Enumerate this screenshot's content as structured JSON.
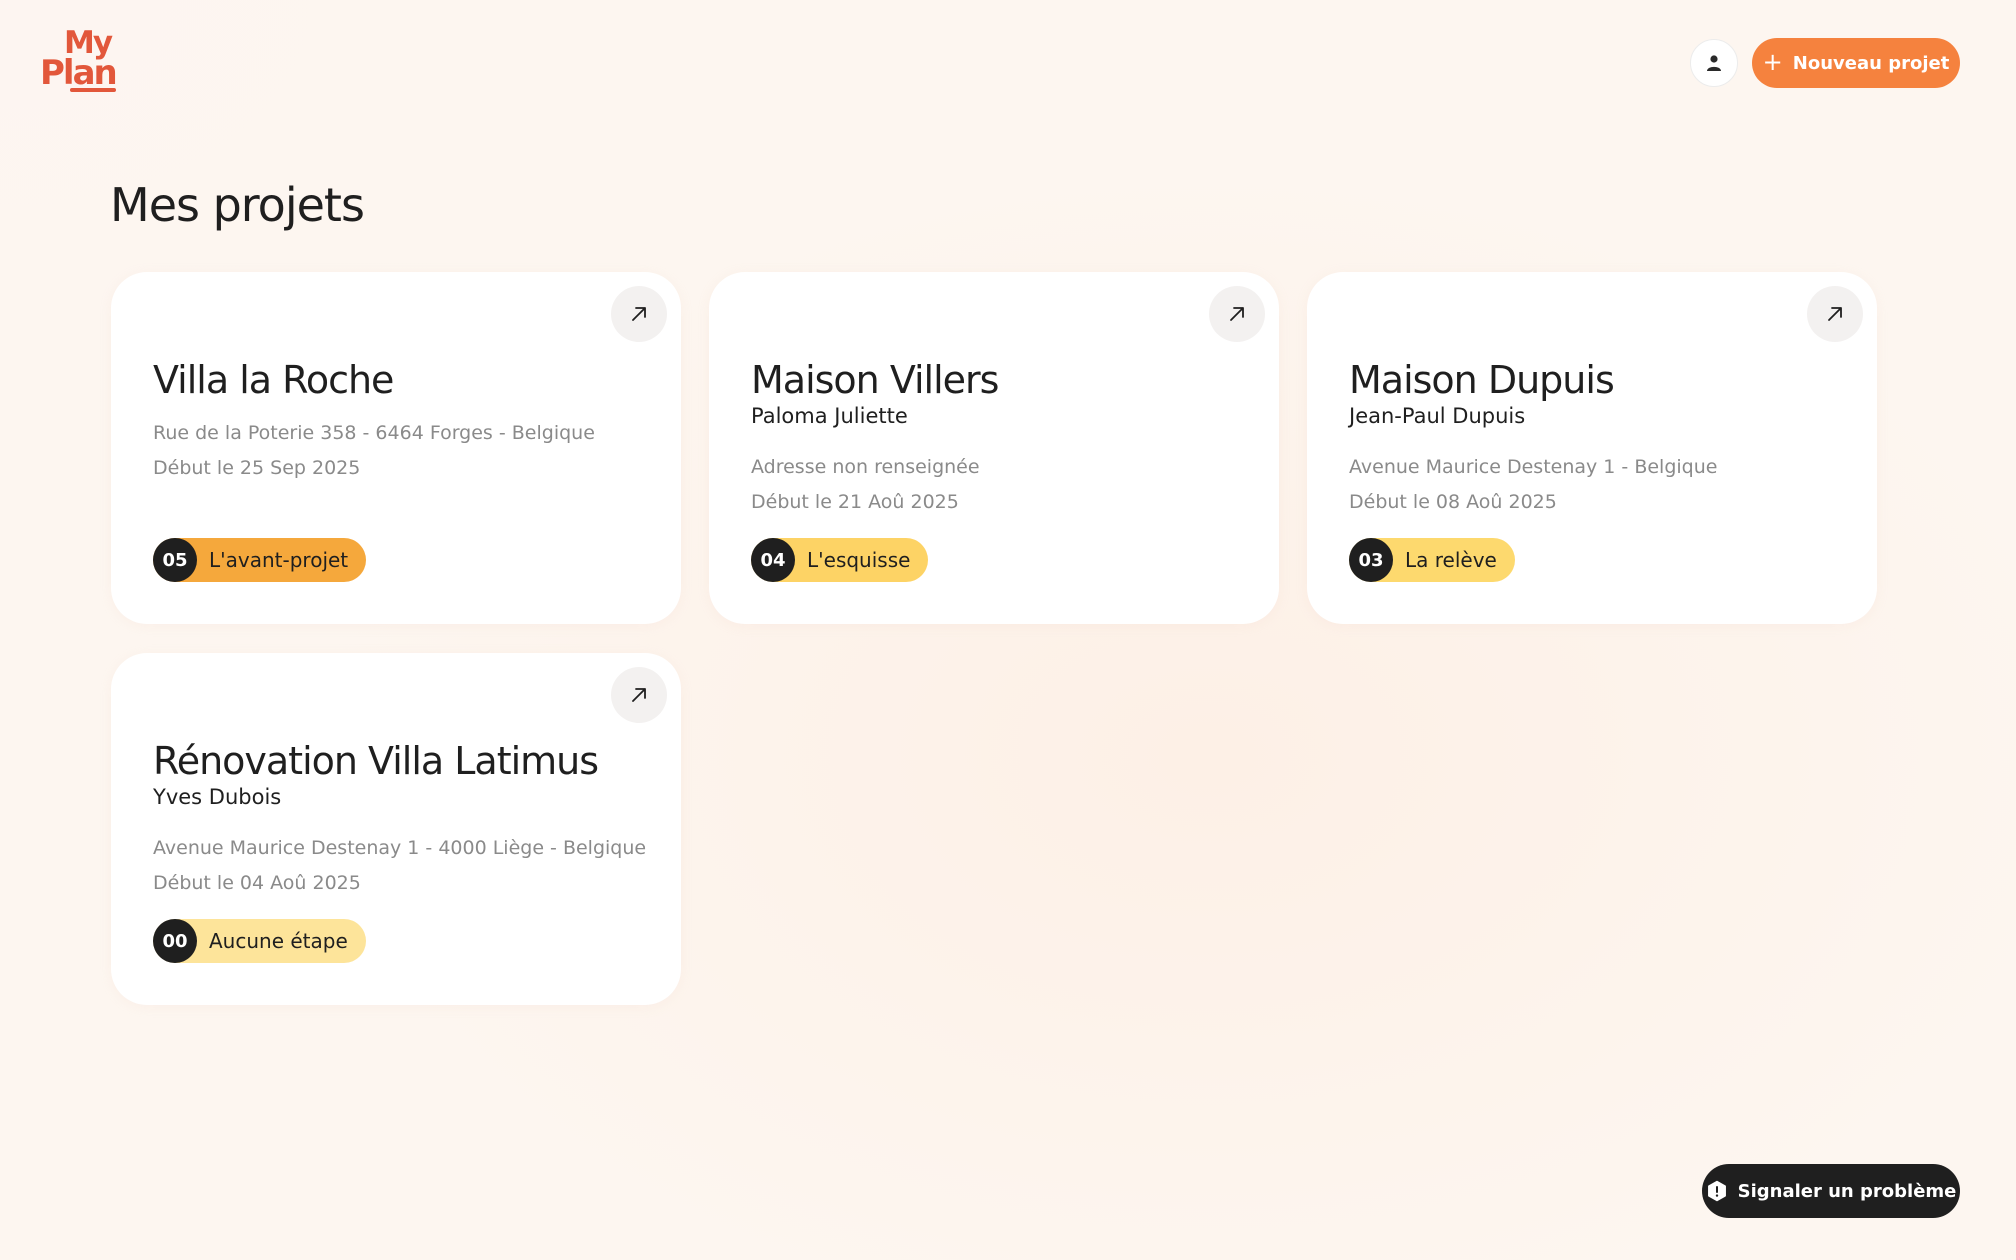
{
  "brand": {
    "line1": "My",
    "line2": "Plan",
    "color": "#e2573b"
  },
  "header": {
    "new_project_label": "Nouveau projet",
    "accent": "#f5823e"
  },
  "main": {
    "title": "Mes projets"
  },
  "projects": [
    {
      "title": "Villa la Roche",
      "client": "",
      "address": "Rue de la Poterie 358 - 6464 Forges - Belgique",
      "start": "Début le 25 Sep 2025",
      "stage_num": "05",
      "stage_label": "L'avant-projet",
      "stage_color": "#f5a83c"
    },
    {
      "title": "Maison Villers",
      "client": "Paloma Juliette",
      "address": "Adresse non renseignée",
      "start": "Début le 21 Aoû 2025",
      "stage_num": "04",
      "stage_label": "L'esquisse",
      "stage_color": "#fdd365"
    },
    {
      "title": "Maison Dupuis",
      "client": "Jean-Paul Dupuis",
      "address": "Avenue Maurice Destenay 1 - Belgique",
      "start": "Début le 08 Aoû 2025",
      "stage_num": "03",
      "stage_label": "La relève",
      "stage_color": "#fdd96e"
    },
    {
      "title": "Rénovation Villa Latimus",
      "client": "Yves Dubois",
      "address": "Avenue Maurice Destenay 1 - 4000 Liège - Belgique",
      "start": "Début le 04 Aoû 2025",
      "stage_num": "00",
      "stage_label": "Aucune étape",
      "stage_color": "#fde49a"
    }
  ],
  "footer": {
    "report_label": "Signaler un problème"
  }
}
